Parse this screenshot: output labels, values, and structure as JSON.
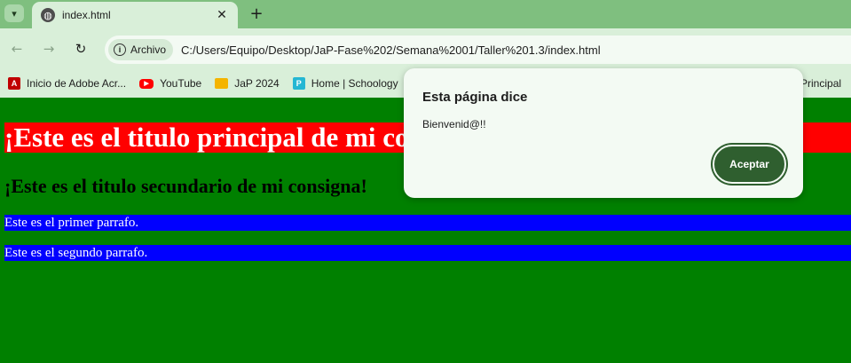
{
  "browser": {
    "tab": {
      "title": "index.html",
      "favicon": "globe-icon"
    },
    "address": {
      "chip_label": "Archivo",
      "url": "C:/Users/Equipo/Desktop/JaP-Fase%202/Semana%2001/Taller%201.3/index.html"
    },
    "bookmarks": [
      {
        "label": "Inicio de Adobe Acr...",
        "icon": "adobe-acrobat-icon"
      },
      {
        "label": "YouTube",
        "icon": "youtube-icon"
      },
      {
        "label": "JaP 2024",
        "icon": "folder-icon"
      },
      {
        "label": "Home | Schoology",
        "icon": "schoology-icon"
      }
    ],
    "bookmark_partial": "a Principal"
  },
  "page": {
    "h1": "¡Este es el titulo principal de mi consigna!",
    "h2": "¡Este es el titulo secundario de mi consigna!",
    "p1": "Este es el primer parrafo.",
    "p2": "Este es el segundo parrafo."
  },
  "dialog": {
    "title": "Esta página dice",
    "message": "Bienvenid@!!",
    "ok_label": "Aceptar"
  },
  "colors": {
    "page_background": "#008000",
    "h1_background": "#ff0000",
    "paragraph_background": "#0000ff",
    "browser_frame": "#7fbf7f",
    "dialog_button": "#2f5f2f"
  }
}
